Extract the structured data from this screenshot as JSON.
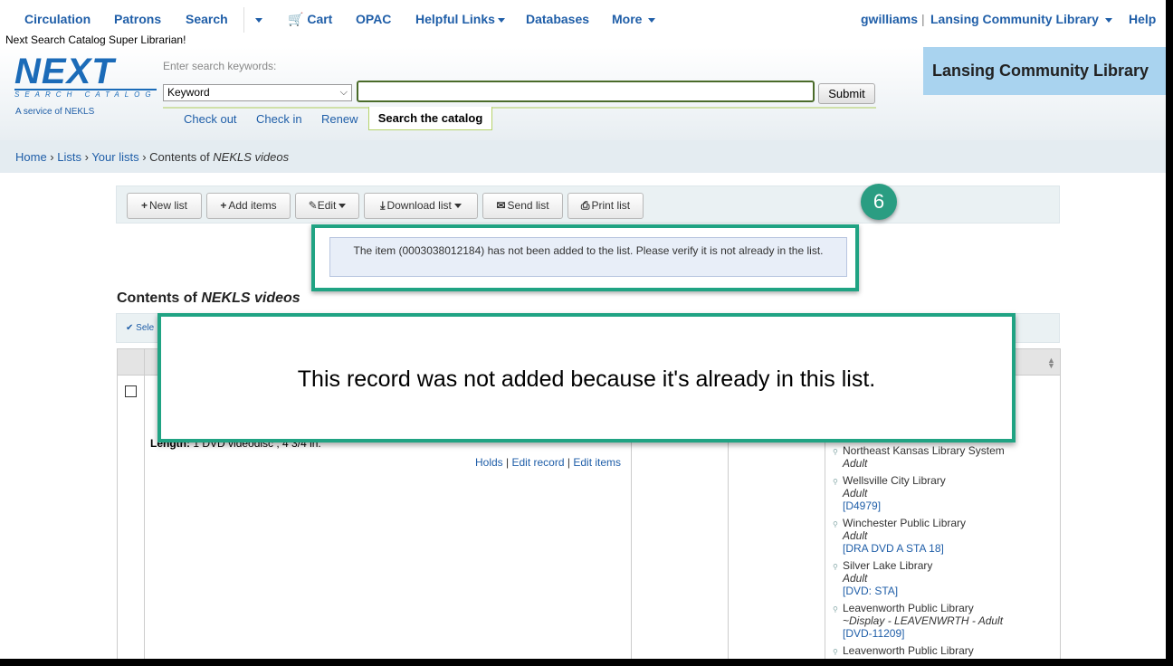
{
  "nav": {
    "circulation": "Circulation",
    "patrons": "Patrons",
    "search": "Search",
    "cart": "Cart",
    "opac": "OPAC",
    "helpful_links": "Helpful Links",
    "databases": "Databases",
    "more": "More",
    "user": "gwilliams",
    "library": "Lansing Community Library",
    "help": "Help"
  },
  "welcome": "Next Search Catalog Super Librarian!",
  "logo": {
    "brand": "NEXT",
    "tagline": "SEARCH CATALOG",
    "service": "A service of NEKLS"
  },
  "search": {
    "label": "Enter search keywords:",
    "type_selected": "Keyword",
    "query": "",
    "submit": "Submit",
    "tabs": [
      "Check out",
      "Check in",
      "Renew"
    ],
    "active_tab": "Search the catalog"
  },
  "library_box": "Lansing Community Library",
  "breadcrumb": {
    "home": "Home",
    "lists": "Lists",
    "your_lists": "Your lists",
    "contents_prefix": "Contents of ",
    "list_name": "NEKLS videos"
  },
  "toolbar": {
    "new_list": "New list",
    "add_items": "Add items",
    "edit": "Edit",
    "download_list": "Download list",
    "send_list": "Send list",
    "print_list": "Print list"
  },
  "step_number": "6",
  "message": "The item (0003038012184) has not been added to the list. Please verify it is not already in the list.",
  "contents": {
    "prefix": "Contents of ",
    "list_name": "NEKLS videos"
  },
  "select_bar": "✔ Sele",
  "row": {
    "length_label": "Length:",
    "length_value": "1 DVD videodisc ; 4 3/4 in.",
    "links": {
      "holds": "Holds",
      "edit_record": "Edit record",
      "edit_items": "Edit items"
    }
  },
  "availability": [
    {
      "library": "Northeast Kansas Library System",
      "location": "Adult",
      "call": ""
    },
    {
      "library": "Wellsville City Library",
      "location": "Adult",
      "call": "[D4979]"
    },
    {
      "library": "Winchester Public Library",
      "location": "Adult",
      "call": "[DRA DVD A STA 18]"
    },
    {
      "library": "Silver Lake Library",
      "location": "Adult",
      "call": "[DVD: STA]"
    },
    {
      "library": "Leavenworth Public Library",
      "location": "~Display - LEAVENWRTH - Adult",
      "call": "[DVD-11209]"
    },
    {
      "library": "Leavenworth Public Library",
      "location": "",
      "call": ""
    }
  ],
  "callout": "This record was not added because it's already in this list."
}
